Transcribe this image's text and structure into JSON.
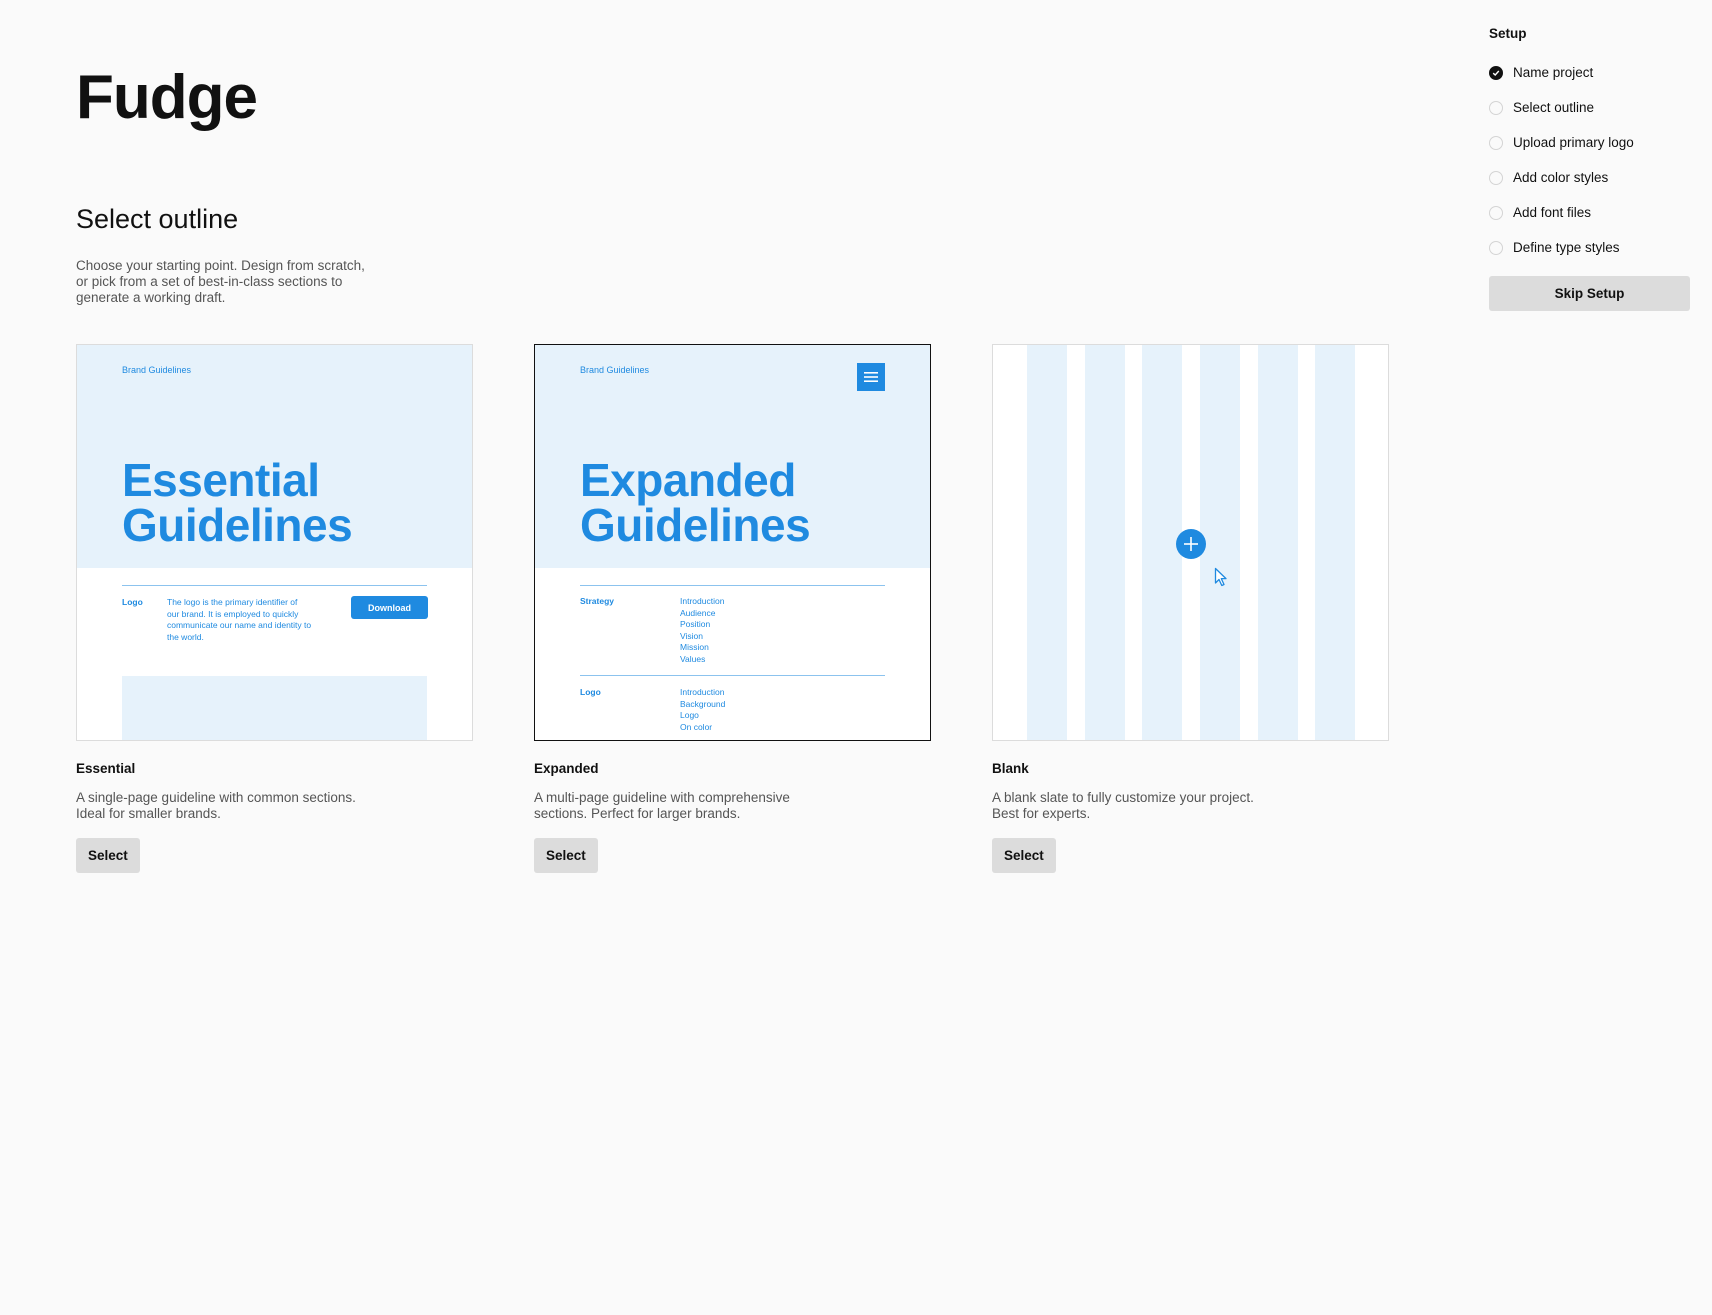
{
  "app": {
    "title": "Fudge"
  },
  "main": {
    "title": "Select outline",
    "description": "Choose your starting point. Design from scratch, or pick from a set of best-in-class sections to generate a working draft."
  },
  "setup": {
    "title": "Setup",
    "steps": [
      {
        "label": "Name project",
        "done": true
      },
      {
        "label": "Select outline",
        "done": false
      },
      {
        "label": "Upload primary logo",
        "done": false
      },
      {
        "label": "Add color styles",
        "done": false
      },
      {
        "label": "Add font files",
        "done": false
      },
      {
        "label": "Define type styles",
        "done": false
      }
    ],
    "skip_label": "Skip Setup"
  },
  "cards": [
    {
      "name": "Essential",
      "description": "A single-page guideline with common sections. Ideal for smaller brands.",
      "select_label": "Select",
      "preview": {
        "brand": "Brand Guidelines",
        "title_line1": "Essential",
        "title_line2": "Guidelines",
        "section_label": "Logo",
        "section_text": "The logo is the primary identifier of our brand. It is employed to quickly communicate our name and identity to the world.",
        "button_label": "Download"
      }
    },
    {
      "name": "Expanded",
      "description": "A multi-page guideline with comprehensive sections. Perfect for larger brands.",
      "select_label": "Select",
      "selected": true,
      "preview": {
        "brand": "Brand Guidelines",
        "title_line1": "Expanded",
        "title_line2": "Guidelines",
        "sections": [
          {
            "label": "Strategy",
            "items": [
              "Introduction",
              "Audience",
              "Position",
              "Vision",
              "Mission",
              "Values"
            ]
          },
          {
            "label": "Logo",
            "items": [
              "Introduction",
              "Background",
              "Logo",
              "On color"
            ]
          }
        ]
      }
    },
    {
      "name": "Blank",
      "description": "A blank slate to fully customize your project. Best for experts.",
      "select_label": "Select"
    }
  ],
  "colors": {
    "accent": "#1f8ae0",
    "accent_light": "#e6f2fb",
    "button_bg": "#dcdcdc"
  },
  "icons": {
    "step_done": "check-circle-icon",
    "step_todo": "empty-circle-icon",
    "menu": "hamburger-menu-icon",
    "add": "plus-icon",
    "cursor": "mouse-pointer-icon"
  }
}
